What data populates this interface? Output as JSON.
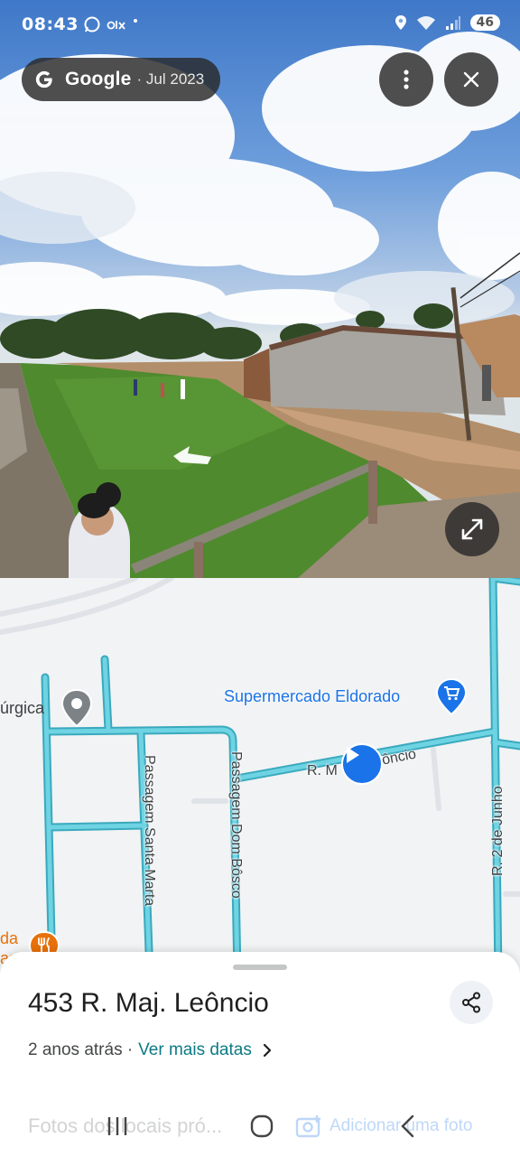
{
  "status_bar": {
    "time": "08:43",
    "battery": "46",
    "left_icons": [
      "whatsapp-icon",
      "olx-icon",
      "dot-icon"
    ],
    "right_icons": [
      "location-icon",
      "wifi-icon",
      "signal-icon",
      "battery-icon"
    ]
  },
  "street_view": {
    "source": "Google",
    "date": "· Jul 2023",
    "buttons": [
      "more-vert-icon",
      "close-icon",
      "expand-icon"
    ]
  },
  "map": {
    "poi_supermarket": "Supermercado Eldorado",
    "poi_left_partial": "úrgica",
    "poi_restaurant_partial_1": "da",
    "poi_restaurant_partial_2": "as",
    "street_main": "R. M",
    "street_main_tail": "ôncio",
    "street_santa_marta": "Passagem Santa Marta",
    "street_dom_bosco": "Passagem Dom Bôsco",
    "street_2_junho": "R. 2 de Junho",
    "colors": {
      "road": "#5ec4d6",
      "poi_blue": "#1a73e8",
      "poi_orange": "#e8710a"
    }
  },
  "sheet": {
    "address": "453 R. Maj. Leôncio",
    "age": "2 anos atrás ·",
    "more_dates": "Ver mais datas",
    "faded_left": "Fotos dos locais pró...",
    "faded_right": "Adicionar uma foto"
  }
}
